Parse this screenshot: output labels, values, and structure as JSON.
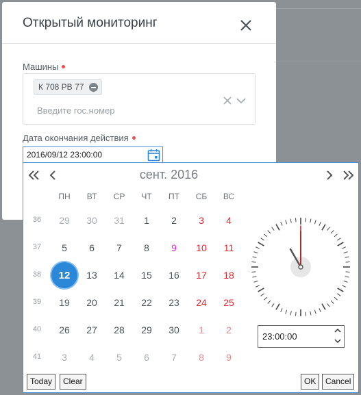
{
  "dialog": {
    "title": "Открытый мониторинг",
    "machines_label": "Машины",
    "machines_tag": "К 708 РВ 77",
    "machines_placeholder": "Введите гос.номер",
    "end_date_label": "Дата окончания действия",
    "end_date_value": "2016/09/12 23:00:00"
  },
  "picker": {
    "month_title": "сент. 2016",
    "weekdays": [
      "ПН",
      "ВТ",
      "СР",
      "ЧТ",
      "ПТ",
      "СБ",
      "ВС"
    ],
    "weeks": [
      {
        "num": "36",
        "days": [
          "29",
          "30",
          "31",
          "1",
          "2",
          "3",
          "4"
        ]
      },
      {
        "num": "37",
        "days": [
          "5",
          "6",
          "7",
          "8",
          "9",
          "10",
          "11"
        ]
      },
      {
        "num": "38",
        "days": [
          "12",
          "13",
          "14",
          "15",
          "16",
          "17",
          "18"
        ]
      },
      {
        "num": "39",
        "days": [
          "19",
          "20",
          "21",
          "22",
          "23",
          "24",
          "25"
        ]
      },
      {
        "num": "40",
        "days": [
          "26",
          "27",
          "28",
          "29",
          "30",
          "1",
          "2"
        ]
      },
      {
        "num": "41",
        "days": [
          "3",
          "4",
          "5",
          "6",
          "7",
          "8",
          "9"
        ]
      }
    ],
    "selected_day": "12",
    "holiday_day": "9",
    "time_value": "23:00:00",
    "today_label": "Today",
    "clear_label": "Clear",
    "ok_label": "OK",
    "cancel_label": "Cancel"
  },
  "colors": {
    "accent": "#2b88d9",
    "weekend": "#e0252b",
    "holiday": "#d428d4",
    "required_dot": "#f04b4b",
    "clock_second_hand": "#c0282d"
  },
  "icons": [
    "close-icon",
    "tag-remove-icon",
    "clear-icon",
    "chevron-down-icon",
    "calendar-icon",
    "double-chevron-left-icon",
    "chevron-left-icon",
    "chevron-right-icon",
    "double-chevron-right-icon",
    "spin-up-icon",
    "spin-down-icon"
  ]
}
